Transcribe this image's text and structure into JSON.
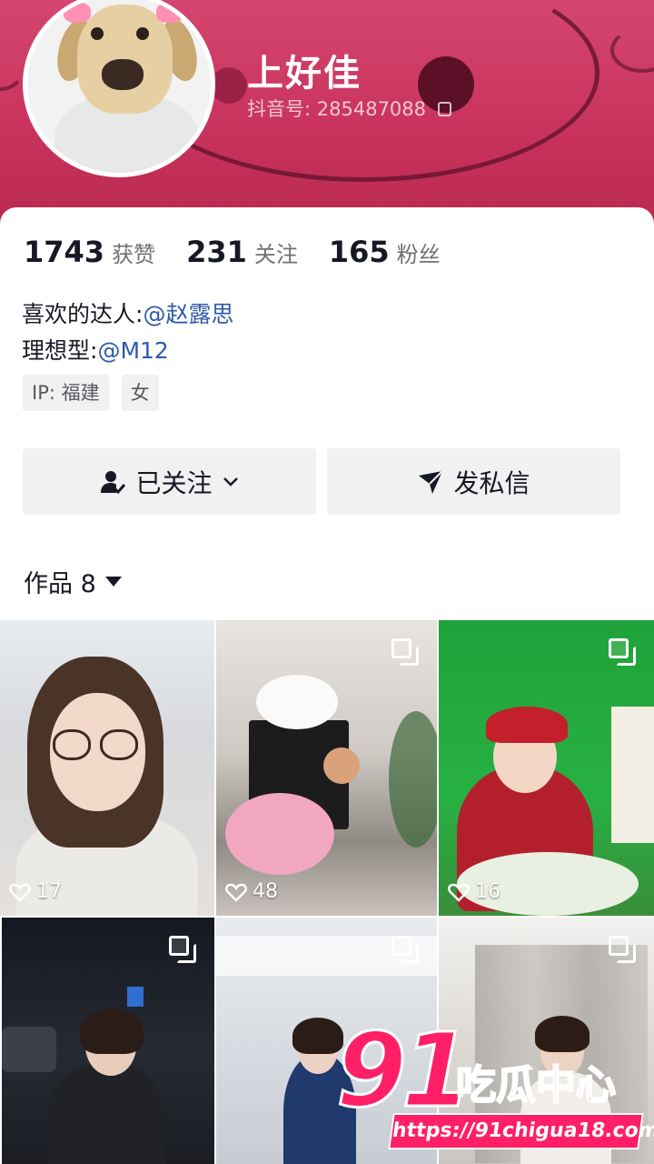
{
  "profile": {
    "name": "上好佳",
    "douyin_id_label": "抖音号:",
    "douyin_id": "285487088"
  },
  "stats": [
    {
      "value": "1743",
      "label": "获赞"
    },
    {
      "value": "231",
      "label": "关注"
    },
    {
      "value": "165",
      "label": "粉丝"
    }
  ],
  "bio": {
    "line1_prefix": "喜欢的达人:",
    "line1_mention": "@赵露思",
    "line2_prefix": "理想型:",
    "line2_mention": "@M12"
  },
  "tags": [
    "IP: 福建",
    "女"
  ],
  "actions": {
    "follow_label": "已关注",
    "message_label": "发私信"
  },
  "works": {
    "label": "作品",
    "count": "8"
  },
  "videos": [
    {
      "likes": "17",
      "multi": false
    },
    {
      "likes": "48",
      "multi": true
    },
    {
      "likes": "16",
      "multi": true
    },
    {
      "likes": "",
      "multi": true
    },
    {
      "likes": "",
      "multi": true
    },
    {
      "likes": "",
      "multi": true
    }
  ],
  "watermark": {
    "number": "91",
    "text": "吃瓜中心",
    "url": "https://91chigua18.com"
  },
  "colors": {
    "banner": "#c8325c",
    "mention": "#2e5aa8",
    "watermark": "#ff1f66"
  }
}
